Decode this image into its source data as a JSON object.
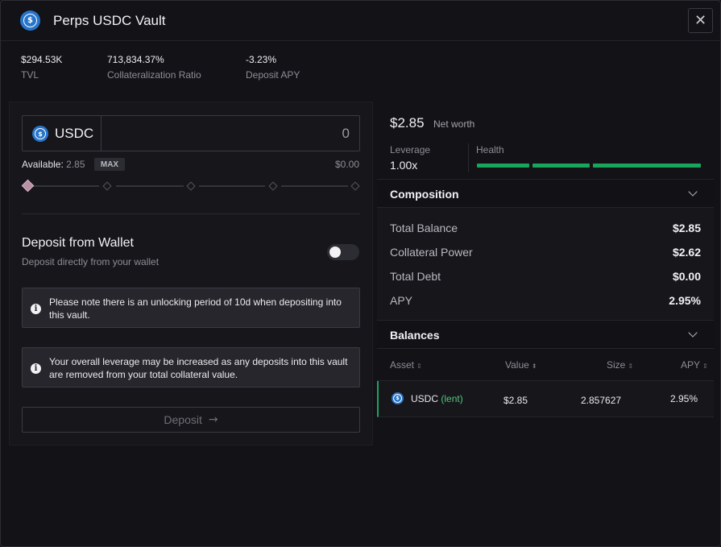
{
  "header": {
    "title": "Perps USDC Vault",
    "close_icon": "close-icon"
  },
  "stats": [
    {
      "value": "$294.53K",
      "label": "TVL"
    },
    {
      "value": "713,834.37%",
      "label": "Collateralization Ratio"
    },
    {
      "value": "-3.23%",
      "label": "Deposit APY"
    }
  ],
  "deposit_form": {
    "asset_symbol": "USDC",
    "amount_value": "0",
    "available_label": "Available:",
    "available_value": "2.85",
    "max_label": "MAX",
    "usd_value": "$0.00",
    "slider_value_fraction": 0,
    "wallet_title": "Deposit from Wallet",
    "wallet_subtitle": "Deposit directly from your wallet",
    "wallet_toggle_on": false,
    "notice_1": "Please note there is an unlocking period of 10d when depositing into this vault.",
    "notice_2": "Your overall leverage may be increased as any deposits into this vault are removed from your total collateral value.",
    "submit_label": "Deposit"
  },
  "account": {
    "net_worth_value": "$2.85",
    "net_worth_label": "Net worth",
    "leverage_label": "Leverage",
    "leverage_value": "1.00x",
    "health_label": "Health",
    "health_fraction": 1.0,
    "health_color": "#1aa55c"
  },
  "composition": {
    "title": "Composition",
    "rows": [
      {
        "label": "Total Balance",
        "value": "$2.85"
      },
      {
        "label": "Collateral Power",
        "value": "$2.62"
      },
      {
        "label": "Total Debt",
        "value": "$0.00"
      },
      {
        "label": "APY",
        "value": "2.95%"
      }
    ]
  },
  "balances": {
    "title": "Balances",
    "columns": [
      "Asset",
      "Value",
      "Size",
      "APY"
    ],
    "rows": [
      {
        "asset": "USDC",
        "tag": "(lent)",
        "value": "$2.85",
        "size": "2.857627",
        "apy": "2.95%"
      }
    ]
  },
  "colors": {
    "accent_green": "#1aa55c",
    "usdc_blue": "#2775ca",
    "slider_thumb": "#b891a4"
  }
}
